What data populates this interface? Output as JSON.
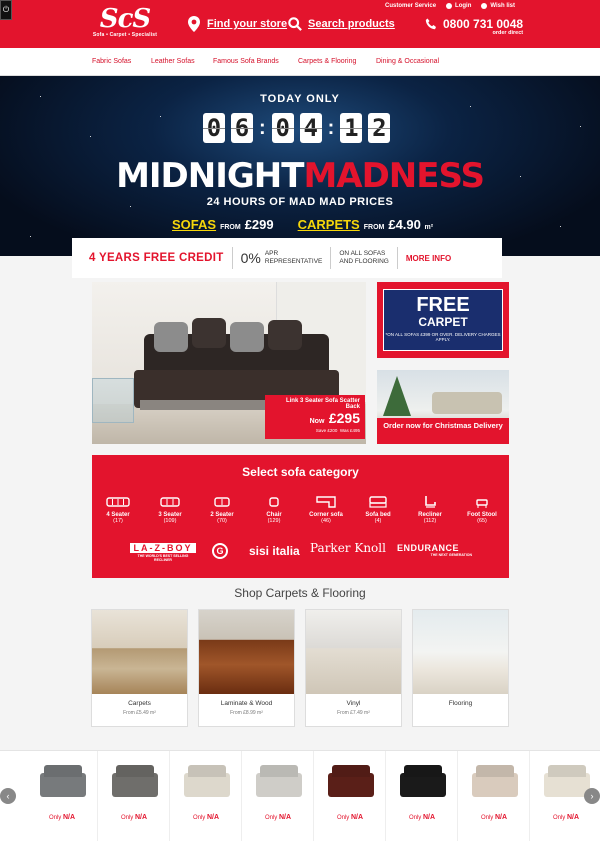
{
  "header": {
    "logo_mark": "ScS",
    "logo_sub": "Sofa • Carpet • Specialist",
    "find_store": "Find your store",
    "search": "Search products",
    "utility": [
      "Customer Service",
      "Login",
      "Wish list"
    ],
    "phone": "0800 731 0048",
    "phone_sub": "order direct",
    "brand_color": "#e3142d"
  },
  "nav": [
    "Fabric Sofas",
    "Leather Sofas",
    "Famous Sofa Brands",
    "Carpets & Flooring",
    "Dining & Occasional"
  ],
  "hero": {
    "today": "TODAY ONLY",
    "timer": [
      "0",
      "6",
      "0",
      "4",
      "1",
      "2"
    ],
    "title_white": "MIDNIGHT",
    "title_red": "MADNESS",
    "subtitle": "24 HOURS OF MAD MAD PRICES",
    "sofas_label": "SOFAS",
    "sofas_from": "FROM",
    "sofas_price": "£299",
    "carpets_label": "CARPETS",
    "carpets_from": "FROM",
    "carpets_price": "£4.90",
    "carpets_unit": "m²"
  },
  "credit": {
    "title": "4 YEARS FREE CREDIT",
    "pct": "0%",
    "apr_1": "APR",
    "apr_2": "REPRESENTATIVE",
    "on_1": "ON ALL SOFAS",
    "on_2": "AND FLOORING",
    "more": "MORE INFO"
  },
  "promo": {
    "sofa_name": "Link 3 Seater Sofa Scatter Back",
    "now": "Now",
    "price": "£295",
    "save": "Save £200",
    "was": "Was £495",
    "free_big": "FREE",
    "free_med": "CARPET",
    "free_small": "*ON ALL SOFAS £399 OR OVER. DELIVERY CHARGES APPLY.",
    "xmas": "Order now for Christmas Delivery"
  },
  "categories": {
    "title": "Select sofa category",
    "items": [
      {
        "name": "4 Seater",
        "count": "(17)"
      },
      {
        "name": "3 Seater",
        "count": "(109)"
      },
      {
        "name": "2 Seater",
        "count": "(70)"
      },
      {
        "name": "Chair",
        "count": "(129)"
      },
      {
        "name": "Corner sofa",
        "count": "(46)"
      },
      {
        "name": "Sofa bed",
        "count": "(4)"
      },
      {
        "name": "Recliner",
        "count": "(112)"
      },
      {
        "name": "Foot Stool",
        "count": "(65)"
      }
    ],
    "brands": [
      "LA-Z-BOY",
      "THE WORLD'S BEST SELLING RECLINER",
      "G",
      "sisi italia",
      "Parker Knoll",
      "ENDURANCE",
      "THE NEXT GENERATION"
    ]
  },
  "carpets": {
    "title": "Shop Carpets & Flooring",
    "items": [
      {
        "name": "Carpets",
        "price": "From £5.49 m²"
      },
      {
        "name": "Laminate & Wood",
        "price": "From £8.99 m²"
      },
      {
        "name": "Vinyl",
        "price": "From £7.49 m²"
      },
      {
        "name": "Flooring",
        "price": ""
      }
    ]
  },
  "carousel": {
    "only": "Only",
    "na": "N/A",
    "prev": "‹",
    "next": "›"
  },
  "power": "⏻"
}
